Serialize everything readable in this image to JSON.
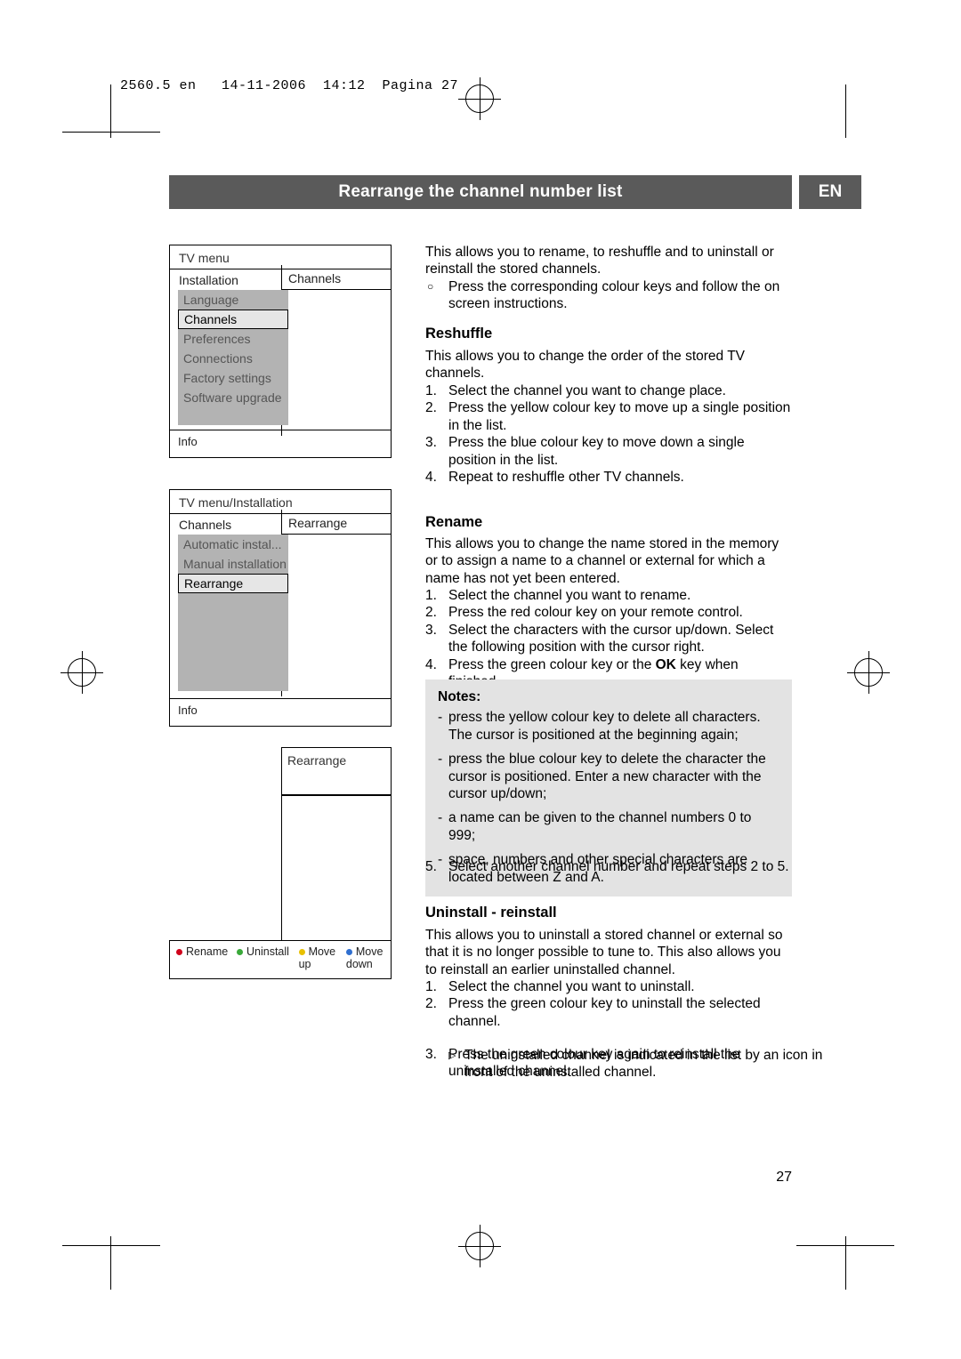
{
  "print_slug": "2560.5 en   14-11-2006  14:12  Pagina 27",
  "header": {
    "title": "Rearrange the channel number list",
    "lang_badge": "EN"
  },
  "page_number": "27",
  "osd_panels": [
    {
      "name": "tv-menu-panel",
      "title": "TV menu",
      "row_label": "Installation",
      "right_label": "Channels",
      "items": [
        "Language",
        "Channels",
        "Preferences",
        "Connections",
        "Factory settings",
        "Software upgrade"
      ],
      "selected": "Channels",
      "info_label": "Info"
    },
    {
      "name": "installation-panel",
      "title": "TV menu/Installation",
      "row_label": "Channels",
      "right_label": "Rearrange",
      "items": [
        "Automatic instal...",
        "Manual installation",
        "Rearrange",
        "",
        "",
        "",
        ""
      ],
      "selected": "Rearrange",
      "info_label": "Info"
    },
    {
      "name": "rearrange-panel",
      "title": "Rearrange",
      "colour_keys": [
        {
          "label": "Rename",
          "color": "#d0021b"
        },
        {
          "label": "Uninstall",
          "color": "#3aa93a"
        },
        {
          "label": "Move up",
          "color": "#e8c000"
        },
        {
          "label": "Move down",
          "color": "#2f6fd0"
        }
      ]
    }
  ],
  "content": {
    "intro": "This allows you to rename, to reshuffle and to uninstall or reinstall the stored channels.",
    "intro_bullet": "Press the corresponding colour keys and follow the on screen instructions.",
    "reshuffle": {
      "heading": "Reshuffle",
      "body": "This allows you to change the order of the stored TV channels.",
      "steps": [
        "Select the channel you want to change place.",
        "Press the yellow colour key  to move up a single position in the list.",
        "Press the blue colour key to move down a single position in the list.",
        "Repeat to reshuffle other TV channels."
      ]
    },
    "rename": {
      "heading": "Rename",
      "body": "This allows you to change the name stored in the memory or to assign a name to a channel or external for which a name has not yet been entered.",
      "steps": [
        "Select the channel you want to rename.",
        "Press the red colour key on your remote control.",
        "Select the characters with the cursor up/down. Select the following position with the cursor right.",
        "Press the green colour key or the OK key when finished."
      ],
      "step4_prefix": "Press the green colour key or the ",
      "step4_bold": "OK",
      "step4_suffix": " key when finished.",
      "notes_heading": "Notes",
      "notes": [
        "press the yellow colour key to delete all characters. The cursor is positioned at the beginning again;",
        "press the blue colour key to delete the character the cursor is positioned. Enter a new character with the cursor up/down;",
        "a name can be given to the channel numbers 0 to 999;",
        "space, numbers and other special characters are located between Z and A."
      ],
      "step5": "Select another channel number and repeat steps 2 to 5."
    },
    "uninstall": {
      "heading": "Uninstall - reinstall",
      "body": "This allows you to uninstall a stored channel or external so that it is no longer possible to tune to. This also allows you to reinstall an earlier uninstalled channel.",
      "steps": [
        "Select the channel you want to uninstall.",
        "Press the green colour key to uninstall the selected channel.",
        "Press the green colour key again to reinstall the uninstalled channel."
      ],
      "sub_note": "The uninstalled channel is indicated in the list by an icon in front of the uninstalled channel."
    }
  }
}
